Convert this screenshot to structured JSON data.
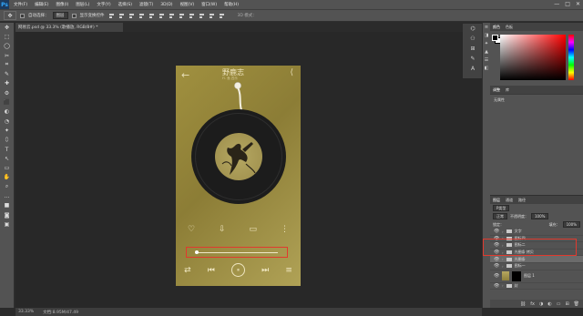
{
  "menubar": {
    "logo": "Ps",
    "items": [
      "文件(F)",
      "编辑(E)",
      "图像(I)",
      "图层(L)",
      "文字(Y)",
      "选择(S)",
      "滤镜(T)",
      "3D(D)",
      "视图(V)",
      "窗口(W)",
      "帮助(H)"
    ],
    "window_controls": [
      "—",
      "□",
      "✕"
    ]
  },
  "options": {
    "tool_icon": "✥",
    "auto_select_label": "自动选择：",
    "auto_select_value": "图层",
    "show_transform_label": "显示变换控件",
    "mode_3d_label": "3D 模式："
  },
  "toolbar": {
    "tools": [
      "✥",
      "⬚",
      "◯",
      "✂",
      "⌗",
      "✎",
      "✚",
      "⚙",
      "⬛",
      "◐",
      "◔",
      "✦",
      "⬯",
      "T",
      "↖",
      "▭",
      "✋",
      "⌕",
      "…",
      "■",
      "◙",
      "▣"
    ]
  },
  "document": {
    "tab_title": "网易云.psd @ 33.3% (歌播放, RGB/8#) *",
    "zoom": "33.33%",
    "doc_size": "文档:8.95M/47.49"
  },
  "artboard": {
    "back_icon": "←",
    "song_title": "野鹿志",
    "artist": "Fl. 鱼 四乐",
    "share_icon": "⟨",
    "actions": [
      "♡",
      "⇩",
      "▭",
      "⋮"
    ],
    "player": [
      "⇄",
      "⏮",
      "⏸",
      "⏭",
      "≡"
    ],
    "progress": 0.02
  },
  "panels_tool": {
    "icons": [
      "⌬",
      "⚇",
      "⊞",
      "✎",
      "A"
    ]
  },
  "mini_column": {
    "icons": [
      "≡",
      "◨",
      "✦",
      "▲",
      "☰",
      "◧"
    ]
  },
  "color": {
    "tabs": [
      "颜色",
      "色板"
    ],
    "foreground": "#000000",
    "background": "#ffffff",
    "hue": "#ff0000"
  },
  "adjust": {
    "tabs": [
      "调整",
      "库"
    ],
    "message": "无属性"
  },
  "layers": {
    "tabs": [
      "图层",
      "通道",
      "路径"
    ],
    "filter_label": "P类型",
    "blend_mode": "正常",
    "opacity_label": "不透明度：",
    "opacity": "100%",
    "lock_label": "锁定：",
    "fill_label": "填充：",
    "fill": "100%",
    "items": [
      {
        "name": "文字",
        "kind": "folder"
      },
      {
        "name": "图标四",
        "kind": "folder"
      },
      {
        "name": "图标二",
        "kind": "folder"
      },
      {
        "name": "光圈条 拷贝",
        "kind": "folder"
      },
      {
        "name": "光圈条",
        "kind": "folder",
        "selected": true
      },
      {
        "name": "图标一",
        "kind": "folder"
      },
      {
        "name": "图层 1",
        "kind": "layer-thumb"
      },
      {
        "name": "封",
        "kind": "folder"
      }
    ],
    "footer_icons": [
      "⛓",
      "fx",
      "◑",
      "◐",
      "▭",
      "⊞",
      "🗑"
    ]
  }
}
